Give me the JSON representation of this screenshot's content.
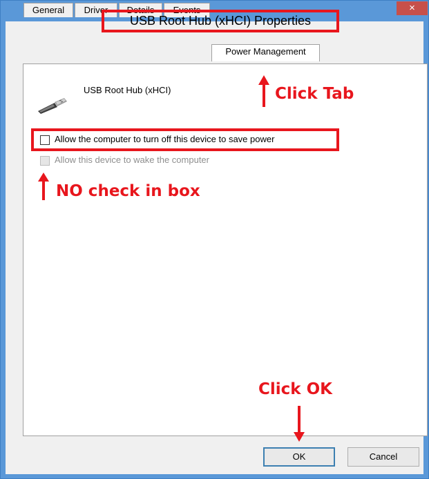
{
  "window": {
    "title": "USB Root Hub (xHCI) Properties",
    "close_glyph": "×"
  },
  "tabs": [
    {
      "label": "General"
    },
    {
      "label": "Driver"
    },
    {
      "label": "Details"
    },
    {
      "label": "Events"
    },
    {
      "label": "Power Management",
      "active": true
    }
  ],
  "device": {
    "name": "USB Root Hub (xHCI)",
    "icon": "usb-cable-icon"
  },
  "options": [
    {
      "label": "Allow the computer to turn off this device to save power",
      "checked": false,
      "enabled": true
    },
    {
      "label": "Allow this device to wake the computer",
      "checked": false,
      "enabled": false
    }
  ],
  "buttons": {
    "ok": "OK",
    "cancel": "Cancel"
  },
  "annotations": {
    "tab": "Click Tab",
    "checkbox": "NO check in box",
    "ok": "Click OK"
  },
  "colors": {
    "annotation_red": "#e8161d",
    "window_frame": "#5a98d8",
    "close_button": "#c7504a"
  }
}
